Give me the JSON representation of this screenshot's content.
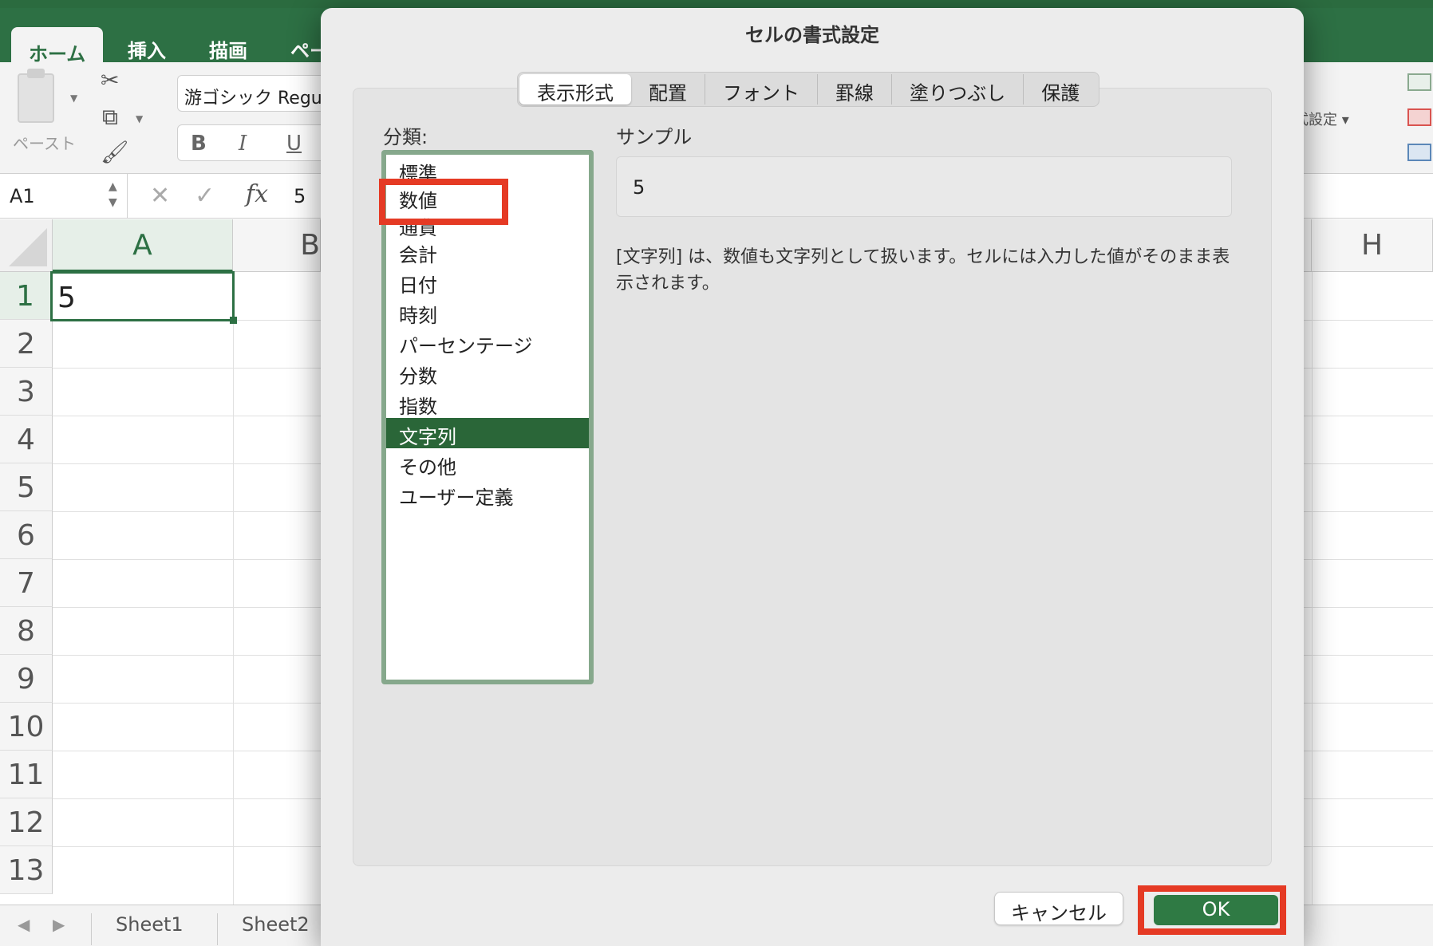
{
  "ribbon": {
    "tabs": [
      "ホーム",
      "挿入",
      "描画",
      "ペー"
    ],
    "paste_label": "ペースト",
    "font_name": "游ゴシック Regular",
    "bold": "B",
    "italic": "I",
    "underline": "U",
    "right_label": "式設定 ▾"
  },
  "formula_bar": {
    "cell_ref": "A1",
    "fx": "fx",
    "value": "5"
  },
  "sheet": {
    "columns": [
      "A",
      "B",
      "H"
    ],
    "rows": [
      "1",
      "2",
      "3",
      "4",
      "5",
      "6",
      "7",
      "8",
      "9",
      "10",
      "11",
      "12",
      "13"
    ],
    "a1_value": "5",
    "tabs": [
      "Sheet1",
      "Sheet2"
    ]
  },
  "dialog": {
    "title": "セルの書式設定",
    "tabs": [
      "表示形式",
      "配置",
      "フォント",
      "罫線",
      "塗りつぶし",
      "保護"
    ],
    "category_label": "分類:",
    "categories": [
      "標準",
      "数値",
      "通貨",
      "会計",
      "日付",
      "時刻",
      "パーセンテージ",
      "分数",
      "指数",
      "文字列",
      "その他",
      "ユーザー定義"
    ],
    "selected_category": "文字列",
    "sample_label": "サンプル",
    "sample_value": "5",
    "description": "[文字列] は、数値も文字列として扱います。セルには入力した値がそのまま表示されます。",
    "cancel_label": "キャンセル",
    "ok_label": "OK"
  },
  "colors": {
    "excel_green": "#2d7044",
    "selection_green": "#2a6638",
    "highlight_red": "#e53a24"
  }
}
